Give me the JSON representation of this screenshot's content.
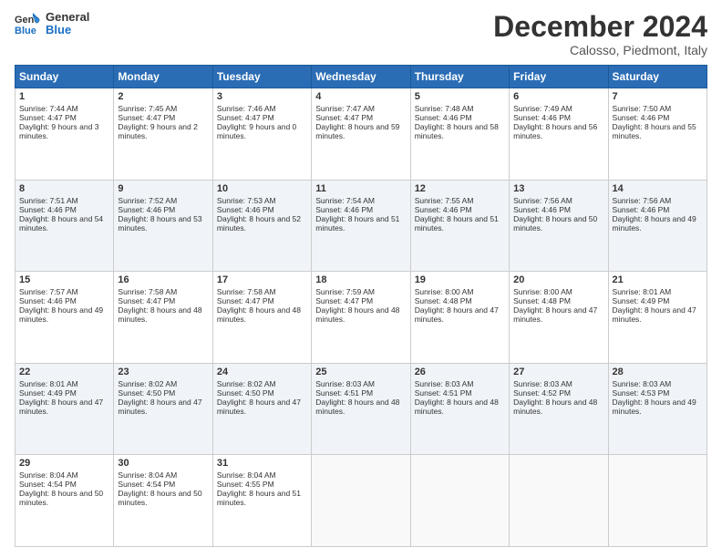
{
  "logo": {
    "line1": "General",
    "line2": "Blue"
  },
  "header": {
    "month": "December 2024",
    "location": "Calosso, Piedmont, Italy"
  },
  "weekdays": [
    "Sunday",
    "Monday",
    "Tuesday",
    "Wednesday",
    "Thursday",
    "Friday",
    "Saturday"
  ],
  "weeks": [
    [
      {
        "day": "1",
        "sunrise": "Sunrise: 7:44 AM",
        "sunset": "Sunset: 4:47 PM",
        "daylight": "Daylight: 9 hours and 3 minutes."
      },
      {
        "day": "2",
        "sunrise": "Sunrise: 7:45 AM",
        "sunset": "Sunset: 4:47 PM",
        "daylight": "Daylight: 9 hours and 2 minutes."
      },
      {
        "day": "3",
        "sunrise": "Sunrise: 7:46 AM",
        "sunset": "Sunset: 4:47 PM",
        "daylight": "Daylight: 9 hours and 0 minutes."
      },
      {
        "day": "4",
        "sunrise": "Sunrise: 7:47 AM",
        "sunset": "Sunset: 4:47 PM",
        "daylight": "Daylight: 8 hours and 59 minutes."
      },
      {
        "day": "5",
        "sunrise": "Sunrise: 7:48 AM",
        "sunset": "Sunset: 4:46 PM",
        "daylight": "Daylight: 8 hours and 58 minutes."
      },
      {
        "day": "6",
        "sunrise": "Sunrise: 7:49 AM",
        "sunset": "Sunset: 4:46 PM",
        "daylight": "Daylight: 8 hours and 56 minutes."
      },
      {
        "day": "7",
        "sunrise": "Sunrise: 7:50 AM",
        "sunset": "Sunset: 4:46 PM",
        "daylight": "Daylight: 8 hours and 55 minutes."
      }
    ],
    [
      {
        "day": "8",
        "sunrise": "Sunrise: 7:51 AM",
        "sunset": "Sunset: 4:46 PM",
        "daylight": "Daylight: 8 hours and 54 minutes."
      },
      {
        "day": "9",
        "sunrise": "Sunrise: 7:52 AM",
        "sunset": "Sunset: 4:46 PM",
        "daylight": "Daylight: 8 hours and 53 minutes."
      },
      {
        "day": "10",
        "sunrise": "Sunrise: 7:53 AM",
        "sunset": "Sunset: 4:46 PM",
        "daylight": "Daylight: 8 hours and 52 minutes."
      },
      {
        "day": "11",
        "sunrise": "Sunrise: 7:54 AM",
        "sunset": "Sunset: 4:46 PM",
        "daylight": "Daylight: 8 hours and 51 minutes."
      },
      {
        "day": "12",
        "sunrise": "Sunrise: 7:55 AM",
        "sunset": "Sunset: 4:46 PM",
        "daylight": "Daylight: 8 hours and 51 minutes."
      },
      {
        "day": "13",
        "sunrise": "Sunrise: 7:56 AM",
        "sunset": "Sunset: 4:46 PM",
        "daylight": "Daylight: 8 hours and 50 minutes."
      },
      {
        "day": "14",
        "sunrise": "Sunrise: 7:56 AM",
        "sunset": "Sunset: 4:46 PM",
        "daylight": "Daylight: 8 hours and 49 minutes."
      }
    ],
    [
      {
        "day": "15",
        "sunrise": "Sunrise: 7:57 AM",
        "sunset": "Sunset: 4:46 PM",
        "daylight": "Daylight: 8 hours and 49 minutes."
      },
      {
        "day": "16",
        "sunrise": "Sunrise: 7:58 AM",
        "sunset": "Sunset: 4:47 PM",
        "daylight": "Daylight: 8 hours and 48 minutes."
      },
      {
        "day": "17",
        "sunrise": "Sunrise: 7:58 AM",
        "sunset": "Sunset: 4:47 PM",
        "daylight": "Daylight: 8 hours and 48 minutes."
      },
      {
        "day": "18",
        "sunrise": "Sunrise: 7:59 AM",
        "sunset": "Sunset: 4:47 PM",
        "daylight": "Daylight: 8 hours and 48 minutes."
      },
      {
        "day": "19",
        "sunrise": "Sunrise: 8:00 AM",
        "sunset": "Sunset: 4:48 PM",
        "daylight": "Daylight: 8 hours and 47 minutes."
      },
      {
        "day": "20",
        "sunrise": "Sunrise: 8:00 AM",
        "sunset": "Sunset: 4:48 PM",
        "daylight": "Daylight: 8 hours and 47 minutes."
      },
      {
        "day": "21",
        "sunrise": "Sunrise: 8:01 AM",
        "sunset": "Sunset: 4:49 PM",
        "daylight": "Daylight: 8 hours and 47 minutes."
      }
    ],
    [
      {
        "day": "22",
        "sunrise": "Sunrise: 8:01 AM",
        "sunset": "Sunset: 4:49 PM",
        "daylight": "Daylight: 8 hours and 47 minutes."
      },
      {
        "day": "23",
        "sunrise": "Sunrise: 8:02 AM",
        "sunset": "Sunset: 4:50 PM",
        "daylight": "Daylight: 8 hours and 47 minutes."
      },
      {
        "day": "24",
        "sunrise": "Sunrise: 8:02 AM",
        "sunset": "Sunset: 4:50 PM",
        "daylight": "Daylight: 8 hours and 47 minutes."
      },
      {
        "day": "25",
        "sunrise": "Sunrise: 8:03 AM",
        "sunset": "Sunset: 4:51 PM",
        "daylight": "Daylight: 8 hours and 48 minutes."
      },
      {
        "day": "26",
        "sunrise": "Sunrise: 8:03 AM",
        "sunset": "Sunset: 4:51 PM",
        "daylight": "Daylight: 8 hours and 48 minutes."
      },
      {
        "day": "27",
        "sunrise": "Sunrise: 8:03 AM",
        "sunset": "Sunset: 4:52 PM",
        "daylight": "Daylight: 8 hours and 48 minutes."
      },
      {
        "day": "28",
        "sunrise": "Sunrise: 8:03 AM",
        "sunset": "Sunset: 4:53 PM",
        "daylight": "Daylight: 8 hours and 49 minutes."
      }
    ],
    [
      {
        "day": "29",
        "sunrise": "Sunrise: 8:04 AM",
        "sunset": "Sunset: 4:54 PM",
        "daylight": "Daylight: 8 hours and 50 minutes."
      },
      {
        "day": "30",
        "sunrise": "Sunrise: 8:04 AM",
        "sunset": "Sunset: 4:54 PM",
        "daylight": "Daylight: 8 hours and 50 minutes."
      },
      {
        "day": "31",
        "sunrise": "Sunrise: 8:04 AM",
        "sunset": "Sunset: 4:55 PM",
        "daylight": "Daylight: 8 hours and 51 minutes."
      },
      null,
      null,
      null,
      null
    ]
  ]
}
